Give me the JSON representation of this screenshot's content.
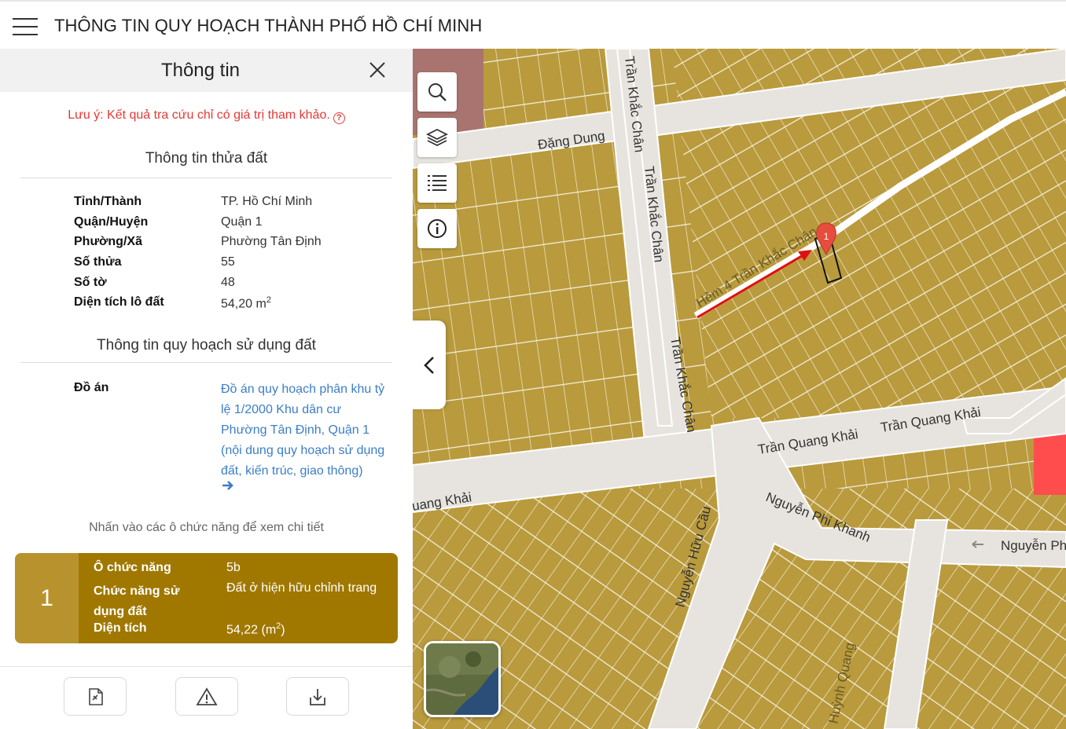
{
  "header": {
    "title": "THÔNG TIN QUY HOẠCH THÀNH PHỐ HỒ CHÍ MINH"
  },
  "panel": {
    "title": "Thông tin",
    "note": "Lưu ý: Kết quả tra cứu chỉ có giá trị tham khảo.",
    "land_section_title": "Thông tin thửa đất",
    "land_info": [
      {
        "label": "Tỉnh/Thành",
        "value": "TP. Hồ Chí Minh"
      },
      {
        "label": "Quận/Huyện",
        "value": "Quận 1"
      },
      {
        "label": "Phường/Xã",
        "value": "Phường Tân Định"
      },
      {
        "label": "Số thửa",
        "value": "55"
      },
      {
        "label": "Số tờ",
        "value": "48"
      },
      {
        "label": "Diện tích lô đất",
        "value": "54,20 m",
        "sup": "2"
      }
    ],
    "plan_section_title": "Thông tin quy hoạch sử dụng đất",
    "plan_label": "Đồ án",
    "plan_link": "Đồ án quy hoạch phân khu tỷ lệ 1/2000 Khu dân cư Phường Tân Định, Quận 1 (nội dung quy hoạch sử dụng đất, kiến trúc, giao thông)",
    "hint": "Nhấn vào các ô chức năng để xem chi tiết",
    "zone": {
      "number": "1",
      "rows": [
        {
          "label": "Ô chức năng",
          "value": "5b"
        },
        {
          "label": "Chức năng sử dụng đất",
          "value": "Đất ở hiện hữu chỉnh trang"
        },
        {
          "label": "Diện tích",
          "value": "54,22 (m",
          "sup": "2",
          "suffix": ")"
        }
      ],
      "color": "#a07800"
    }
  },
  "map": {
    "streets": [
      "Đặng Dung",
      "Trần Khắc Chân",
      "Trần Khắc Chân",
      "Trần Khắc Chân",
      "Hẻm 4 Trần Khắc Chân",
      "Trần Quang Khải",
      "Trần Quang Khải",
      "uang Khải",
      "Nguyễn Phi Khanh",
      "Nguyễn Hữu Cầu",
      "Nguyễn Ph",
      "Huỳnh Quang"
    ],
    "marker_label": "1",
    "land_color": "#b99a3c",
    "highlight_color": "#ff4d4d"
  },
  "icons": {
    "menu": "hamburger-icon",
    "close": "close-icon",
    "search": "search-icon",
    "layers": "layers-icon",
    "list": "list-icon",
    "info": "info-icon",
    "collapse": "chevron-left-icon",
    "doc": "document-icon",
    "warning": "warning-icon",
    "download": "download-icon"
  }
}
